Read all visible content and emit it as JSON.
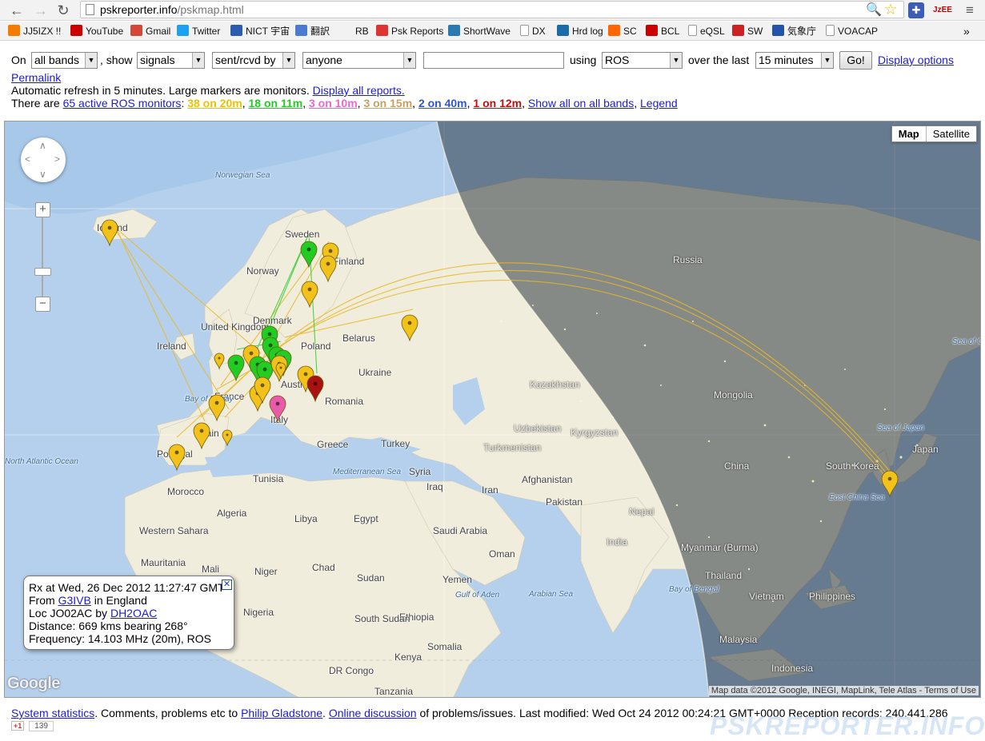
{
  "browser": {
    "url_host": "pskreporter.info",
    "url_path": "/pskmap.html",
    "bookmarks": [
      {
        "label": "JJ5IZX !!",
        "icon": "blogger-icon",
        "color": "#f57c00"
      },
      {
        "label": "YouTube",
        "icon": "youtube-icon",
        "color": "#cc0000"
      },
      {
        "label": "Gmail",
        "icon": "gmail-icon",
        "color": "#d44638"
      },
      {
        "label": "Twitter",
        "icon": "twitter-icon",
        "color": "#1da1f2"
      },
      {
        "label": "NICT 宇宙",
        "icon": "nict-icon",
        "color": "#2a5db0"
      },
      {
        "label": "翻訳",
        "icon": "translate-icon",
        "color": "#4a7bd0"
      },
      {
        "label": "RB",
        "icon": "",
        "color": ""
      },
      {
        "label": "Psk Reports",
        "icon": "psk-icon",
        "color": "#d33"
      },
      {
        "label": "ShortWave",
        "icon": "shortwave-icon",
        "color": "#2a7ab0"
      },
      {
        "label": "DX",
        "icon": "page-icon",
        "color": ""
      },
      {
        "label": "Hrd log",
        "icon": "globe-icon",
        "color": "#1b6ba8"
      },
      {
        "label": "SC",
        "icon": "soundcloud-icon",
        "color": "#ff6600"
      },
      {
        "label": "BCL",
        "icon": "bcl-icon",
        "color": "#c00"
      },
      {
        "label": "eQSL",
        "icon": "page-icon",
        "color": ""
      },
      {
        "label": "SW",
        "icon": "sw-icon",
        "color": "#c22"
      },
      {
        "label": "気象庁",
        "icon": "jma-icon",
        "color": "#2255aa"
      },
      {
        "label": "VOACAP",
        "icon": "page-icon",
        "color": ""
      }
    ]
  },
  "controls": {
    "on_label": "On",
    "bands_value": "all bands",
    "show_label": ", show",
    "show_value": "signals",
    "direction_value": "sent/rcvd by",
    "who_value": "anyone",
    "callsign_value": "",
    "using_label": "using",
    "mode_value": "ROS",
    "over_label": "over the last",
    "period_value": "15 minutes",
    "go_label": "Go!",
    "display_options": "Display options"
  },
  "permalink": "Permalink",
  "refresh_text": "Automatic refresh in 5 minutes. Large markers are monitors.",
  "display_all": "Display all reports.",
  "monitors": {
    "prefix": "There are",
    "active_link": "65 active ROS monitors",
    "colon": ":",
    "bands": [
      {
        "label": "38 on 20m",
        "color": "#f0c000"
      },
      {
        "label": "18 on 11m",
        "color": "#22cc22"
      },
      {
        "label": "3 on 10m",
        "color": "#ee66cc"
      },
      {
        "label": "3 on 15m",
        "color": "#c8a060"
      },
      {
        "label": "2 on 40m",
        "color": "#3355cc"
      },
      {
        "label": "1 on 12m",
        "color": "#bb1111"
      }
    ],
    "show_all": "Show all on all bands",
    "legend": "Legend"
  },
  "map": {
    "type_map": "Map",
    "type_satellite": "Satellite",
    "labels": {
      "norwegian_sea": "Norwegian Sea",
      "iceland": "Iceland",
      "sweden": "Sweden",
      "finland": "Finland",
      "norway": "Norway",
      "russia": "Russia",
      "denmark": "Denmark",
      "uk": "United Kingdom",
      "ireland": "Ireland",
      "belarus": "Belarus",
      "poland": "Poland",
      "ukraine": "Ukraine",
      "kazakhstan": "Kazakhstan",
      "mongolia": "Mongolia",
      "france": "France",
      "austria": "Austria",
      "romania": "Romania",
      "bay_biscay": "Bay of Biscay",
      "spain": "Spain",
      "italy": "Italy",
      "uzbekistan": "Uzbekistan",
      "kyrgyzstan": "Kyrgyzstan",
      "portugal": "Portugal",
      "greece": "Greece",
      "turkey": "Turkey",
      "turkmenistan": "Turkmenistan",
      "china": "China",
      "south_korea": "South Korea",
      "japan": "Japan",
      "sea_japan": "Sea of Japan",
      "sea_okhotsk": "Sea of Okhotsk",
      "north_atlantic": "North Atlantic Ocean",
      "tunisia": "Tunisia",
      "mediterranean": "Mediterranean Sea",
      "syria": "Syria",
      "iraq": "Iraq",
      "iran": "Iran",
      "afghanistan": "Afghanistan",
      "pakistan": "Pakistan",
      "morocco": "Morocco",
      "algeria": "Algeria",
      "libya": "Libya",
      "egypt": "Egypt",
      "nepal": "Nepal",
      "east_china_sea": "East China Sea",
      "western_sahara": "Western Sahara",
      "saudi_arabia": "Saudi Arabia",
      "oman": "Oman",
      "india": "India",
      "mauritania": "Mauritania",
      "mali": "Mali",
      "niger": "Niger",
      "chad": "Chad",
      "sudan": "Sudan",
      "yemen": "Yemen",
      "myanmar": "Myanmar (Burma)",
      "thailand": "Thailand",
      "vietnam": "Vietnam",
      "philippines": "Philippines",
      "arabian_sea": "Arabian Sea",
      "bay_bengal": "Bay of Bengal",
      "gulf_aden": "Gulf of Aden",
      "nigeria": "Nigeria",
      "ethiopia": "Ethiopia",
      "south_sudan": "South Sudan",
      "somalia": "Somalia",
      "malaysia": "Malaysia",
      "kenya": "Kenya",
      "dr_congo": "DR Congo",
      "tanzania": "Tanzania",
      "indonesia": "Indonesia"
    },
    "info": {
      "rx": "Rx at Wed, 26 Dec 2012 11:27:47 GMT",
      "from_label": "From",
      "from_call": "G3IVB",
      "from_country": "in England",
      "loc_label": "Loc JO02AC by",
      "loc_call": "DH2OAC",
      "distance": "Distance: 669 kms bearing 268°",
      "frequency": "Frequency: 14.103 MHz (20m), ROS"
    },
    "google": "Google",
    "attribution": "Map data ©2012 Google, INEGI, MapLink, Tele Atlas - Terms of Use"
  },
  "footer": {
    "system_stats": "System statistics",
    "comments": ". Comments, problems etc to",
    "philip": "Philip Gladstone",
    "dot": ".",
    "online": "Online discussion",
    "rest": "of problems/issues. Last modified: Wed Oct 24 2012 00:24:21 GMT+0000 Reception records: 240,441,286",
    "plus_one": "+1",
    "plus_count": "139",
    "watermark": "PSKREPORTER.INFO"
  }
}
